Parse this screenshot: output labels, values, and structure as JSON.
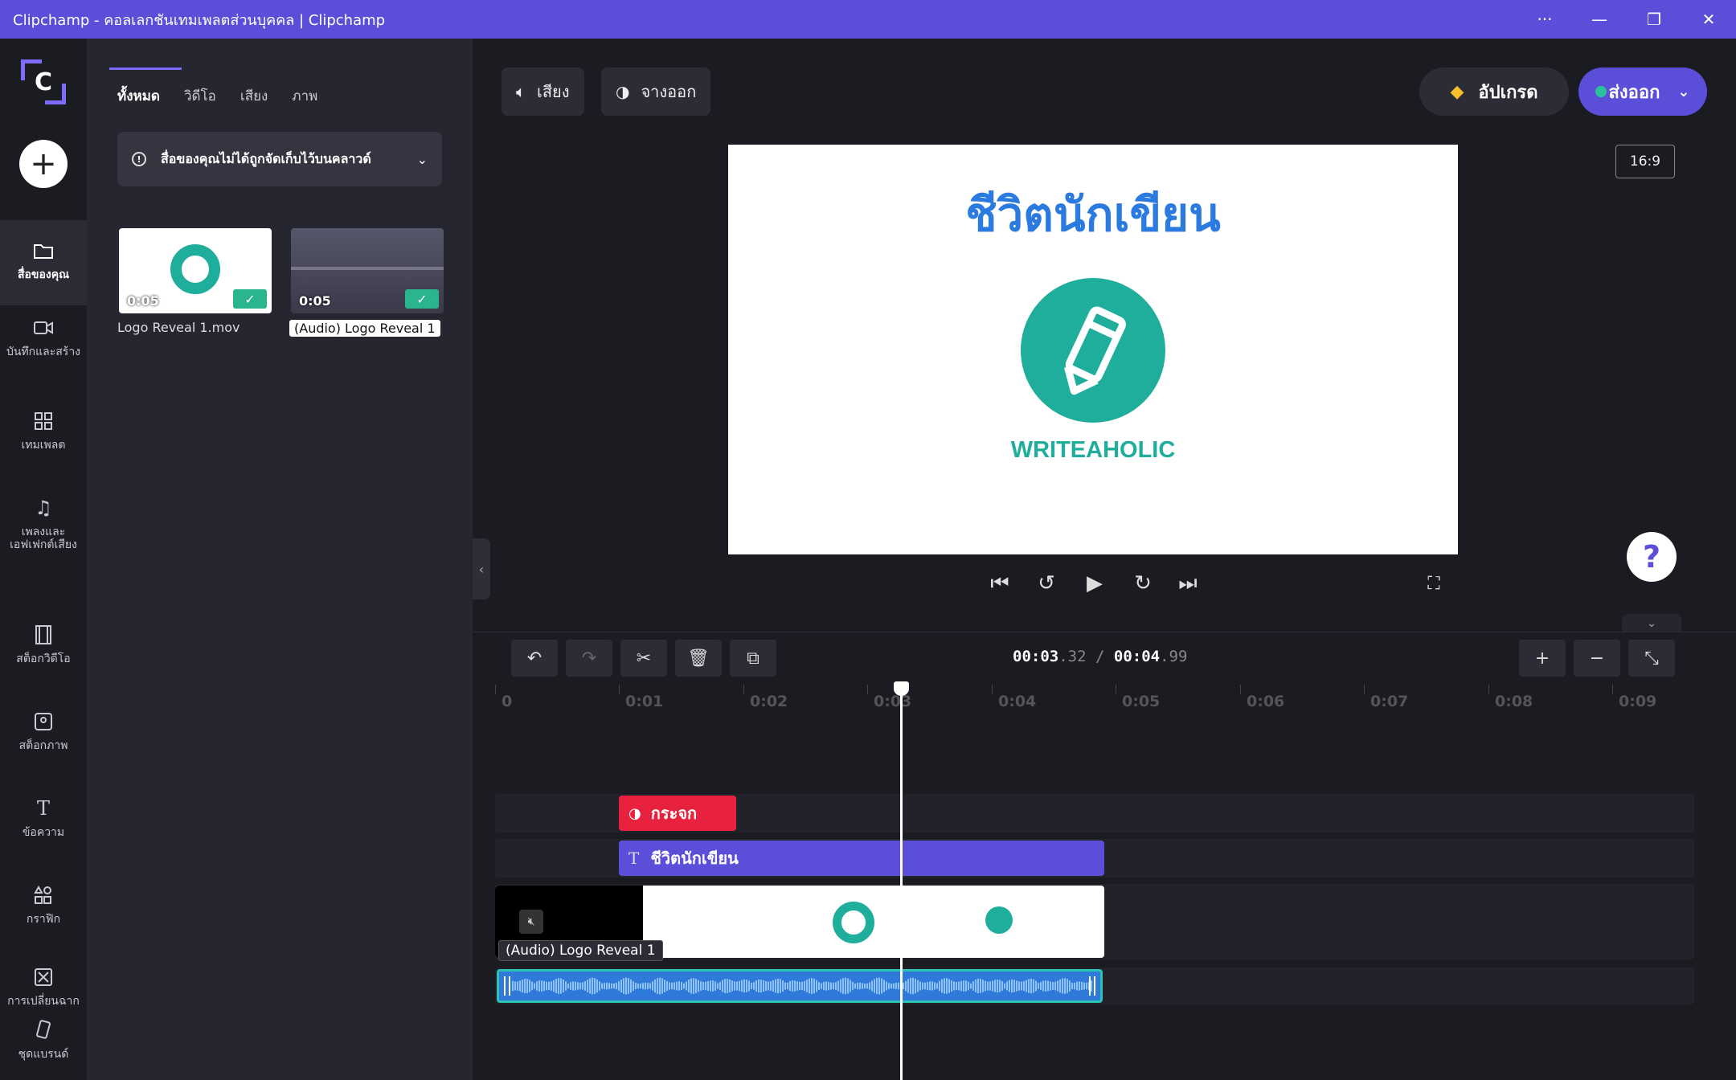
{
  "window": {
    "title": "Clipchamp - คอลเลกชันเทมเพลตส่วนบุคคล | Clipchamp",
    "more_icon": "more-icon",
    "minimize_icon": "minimize-icon",
    "restore_icon": "restore-icon",
    "close_icon": "close-icon"
  },
  "rail": {
    "logo_letter": "C",
    "items": [
      {
        "label": "สื่อของคุณ",
        "icon": "folder-icon",
        "active": true
      },
      {
        "label": "บันทึกและสร้าง",
        "icon": "camera-icon"
      },
      {
        "label": "เทมเพลต",
        "icon": "template-icon"
      },
      {
        "label": "เพลงและเอฟเฟกต์เสียง",
        "icon": "music-icon"
      },
      {
        "label": "สต็อกวิดีโอ",
        "icon": "film-icon"
      },
      {
        "label": "สต็อกภาพ",
        "icon": "image-icon"
      },
      {
        "label": "ข้อความ",
        "icon": "text-icon"
      },
      {
        "label": "กราฟิก",
        "icon": "shapes-icon"
      },
      {
        "label": "การเปลี่ยนฉาก",
        "icon": "transition-icon"
      },
      {
        "label": "ชุดแบรนด์",
        "icon": "brand-icon"
      }
    ]
  },
  "panel": {
    "tabs": [
      "ทั้งหมด",
      "วิดีโอ",
      "เสียง",
      "ภาพ"
    ],
    "cloud_notice": "สื่อของคุณไม่ได้ถูกจัดเก็บไว้บนคลาวด์",
    "media": [
      {
        "name": "Logo Reveal 1.mov",
        "duration": "0:05"
      },
      {
        "name": "(Audio) Logo Reveal 1",
        "duration": "0:05"
      }
    ]
  },
  "toolbar": {
    "audio_label": "เสียง",
    "fade_label": "จางออก",
    "upgrade_label": "อัปเกรด",
    "export_label": "ส่งออก",
    "aspect_ratio": "16:9"
  },
  "preview": {
    "title_text": "ชีวิตนักเขียน",
    "brand_text": "WRITEAHOLIC"
  },
  "timeline": {
    "current_time": "00:03",
    "current_frac": ".32",
    "separator": "/",
    "total_time": "00:04",
    "total_frac": ".99",
    "ruler": [
      "0",
      "0:01",
      "0:02",
      "0:03",
      "0:04",
      "0:05",
      "0:06",
      "0:07",
      "0:08",
      "0:09"
    ],
    "filter_clip": "กระจก",
    "text_clip": "ชีวิตนักเขียน",
    "video_clip_tooltip": "(Audio) Logo Reveal 1"
  },
  "colors": {
    "accent": "#5b4fd9",
    "teal": "#1fae9c",
    "filter_red": "#e8213e",
    "audio_blue": "#2f7ad9"
  }
}
